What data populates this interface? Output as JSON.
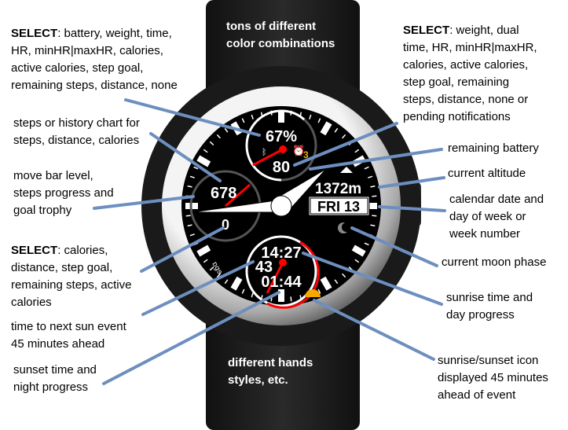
{
  "watch_face": {
    "battery_percent": "67%",
    "heart_rate": "80",
    "alarm_count": "3",
    "steps_value": "678",
    "bottom_left_value": "0",
    "altitude": "1372m",
    "date": "FRI 13",
    "sunrise_time": "14:27",
    "minutes_to_event": "43",
    "sunset_time": "01:44",
    "brand_text": "ɒgɘ",
    "colors": {
      "accent": "#ff0000",
      "sun_icon": "#f5a800",
      "alarm_count": "#f5a800",
      "annotation_line": "#6d8fbf"
    }
  },
  "annotations": {
    "left": [
      {
        "bold": "SELECT",
        "lines": [
          ": battery, weight, time,",
          "HR, minHR|maxHR, calories,",
          "active calories, step goal,",
          "remaining steps, distance, none"
        ]
      },
      {
        "lines": [
          "steps or history chart for",
          "steps, distance, calories"
        ]
      },
      {
        "lines": [
          "move bar level,",
          "steps progress and",
          "goal trophy"
        ]
      },
      {
        "bold": "SELECT",
        "lines": [
          ": calories,",
          "distance, step goal,",
          "remaining steps, active",
          "calories"
        ]
      },
      {
        "lines": [
          "time to next sun event",
          "45 minutes ahead"
        ]
      },
      {
        "lines": [
          "sunset time and",
          "night progress"
        ]
      }
    ],
    "top_center": [
      "tons of different",
      "color combinations"
    ],
    "bottom_center": [
      "different hands",
      "styles, etc."
    ],
    "right": [
      {
        "bold": "SELECT",
        "lines": [
          ": weight, dual",
          "time, HR, minHR|maxHR,",
          "calories, active calories,",
          "step goal, remaining",
          "steps, distance, none or",
          "pending notifications"
        ]
      },
      {
        "lines": [
          "remaining battery"
        ]
      },
      {
        "lines": [
          "current altitude"
        ]
      },
      {
        "lines": [
          "calendar date and",
          "day of week or",
          "week number"
        ]
      },
      {
        "lines": [
          "current moon phase"
        ]
      },
      {
        "lines": [
          "sunrise time and",
          "day progress"
        ]
      },
      {
        "lines": [
          "sunrise/sunset icon",
          "displayed 45 minutes",
          "ahead of event"
        ]
      }
    ]
  }
}
